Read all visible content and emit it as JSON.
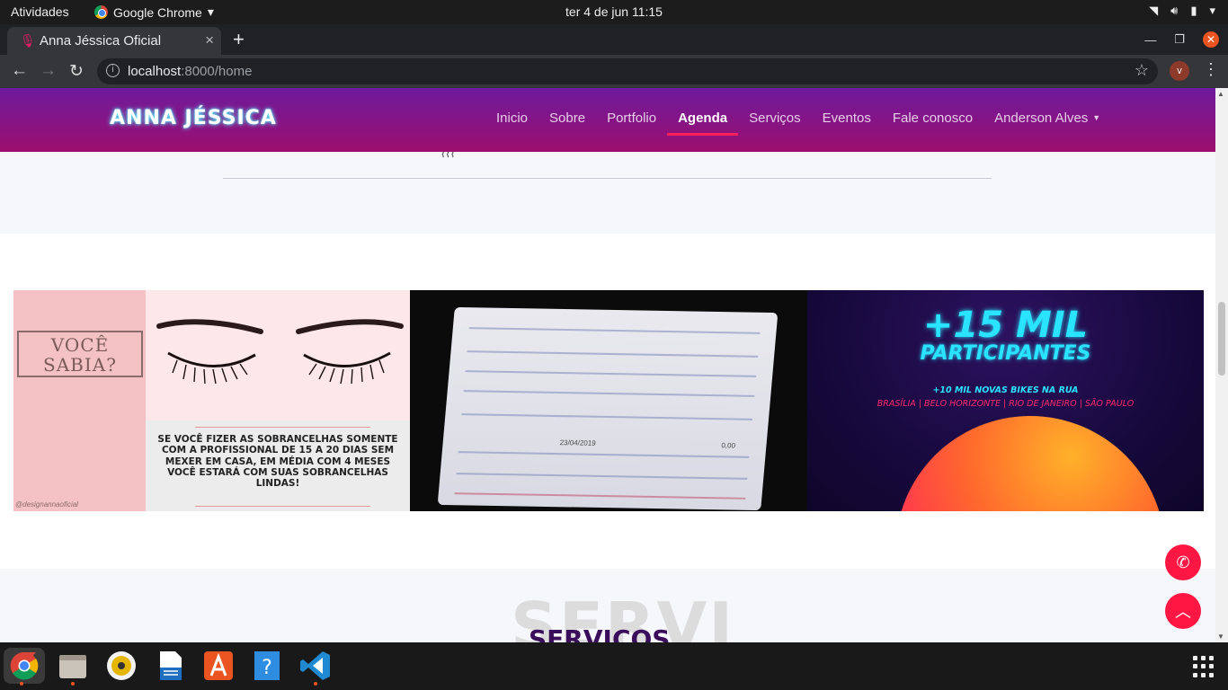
{
  "system": {
    "activities": "Atividades",
    "app_name": "Google Chrome",
    "clock": "ter 4 de jun  11:15"
  },
  "browser": {
    "tab_title": "Anna Jéssica Oficial",
    "url_host": "localhost",
    "url_rest": ":8000/home",
    "profile_initial": "v"
  },
  "site": {
    "logo": "ANNA JÉSSICA",
    "menu": [
      {
        "label": "Inicio"
      },
      {
        "label": "Sobre"
      },
      {
        "label": "Portfolio"
      },
      {
        "label": "Agenda",
        "active": true
      },
      {
        "label": "Serviços"
      },
      {
        "label": "Eventos"
      },
      {
        "label": "Fale conosco"
      },
      {
        "label": "Anderson Alves",
        "dropdown": true
      }
    ],
    "gallery": {
      "card1": {
        "title": "VOCÊ SABIA?",
        "caption": "SE VOCÊ FIZER AS SOBRANCELHAS SOMENTE COM A PROFISSIONAL DE 15 A 20 DIAS SEM MEXER EM CASA, EM MÉDIA COM 4 MESES VOCÊ ESTARÁ COM SUAS SOBRANCELHAS LINDAS!",
        "handle": "@designannaoficial"
      },
      "card2": {
        "date": "23/04/2019",
        "value": "0,00"
      },
      "card3": {
        "headline": "+15 MIL",
        "subheadline": "PARTICIPANTES",
        "tagline": "+10 MIL NOVAS BIKES NA RUA",
        "cities": "BRASÍLIA | BELO HORIZONTE | RIO DE JANEIRO | SÃO PAULO"
      }
    },
    "section_title_bg": "SERVI",
    "section_title": "SERVIÇOS"
  },
  "colors": {
    "navbar_top": "#6e1a9e",
    "navbar_bottom": "#9c0f6e",
    "accent": "#ff1744",
    "logo_glow": "#5ef3ff"
  },
  "dock": {
    "apps": [
      "chrome-icon",
      "files-icon",
      "rhythmbox-icon",
      "writer-icon",
      "software-center-icon",
      "help-icon",
      "vscode-icon"
    ]
  }
}
